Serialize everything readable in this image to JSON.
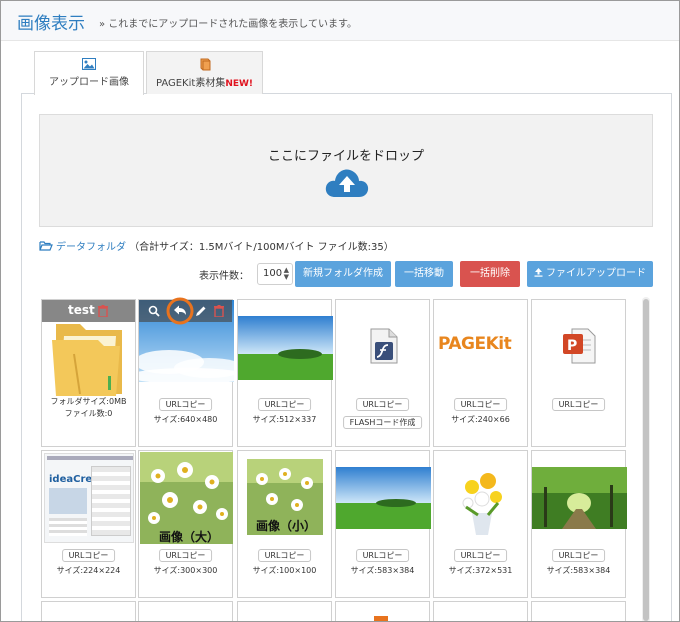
{
  "header": {
    "title": "画像表示",
    "subtitle": "» これまでにアップロードされた画像を表示しています。"
  },
  "tabs": [
    {
      "label": "アップロード画像",
      "icon": "image-icon",
      "active": true
    },
    {
      "label": "PAGEKit素材集",
      "badge": "NEW!",
      "icon": "book-icon",
      "active": false
    }
  ],
  "dropzone": {
    "text": "ここにファイルをドロップ",
    "icon": "cloud-upload-icon"
  },
  "folder": {
    "link": "データフォルダ",
    "info": "（合計サイズ：1.5Mバイト/100Mバイト ファイル数:35）"
  },
  "toolbar": {
    "count_label": "表示件数：",
    "count_value": "100",
    "new_folder": "新規フォルダ作成",
    "move": "一括移動",
    "delete": "一括削除",
    "upload": "ファイルアップロード"
  },
  "grid": {
    "folder_cell": {
      "name": "test",
      "size": "フォルダサイズ:0MB",
      "count": "ファイル数:0"
    },
    "url_copy": "URLコピー",
    "flash_button": "FLASHコード作成",
    "pagekit_logo": "PAGEKit",
    "sizes": {
      "c2": "サイズ:640×480",
      "c3": "サイズ:512×337",
      "c5": "サイズ:240×66",
      "c7": "サイズ:224×224",
      "c8": "サイズ:300×300",
      "c9": "サイズ:100×100",
      "c10": "サイズ:583×384",
      "c11": "サイズ:372×531",
      "c12": "サイズ:583×384"
    },
    "label_large": "画像（大）",
    "label_small": "画像（小）",
    "thumb7_text": "ideaCre"
  },
  "colors": {
    "accent": "#2f7ec0",
    "button_blue": "#5ba3dd",
    "button_red": "#d9534f",
    "highlight": "#e8731e"
  }
}
